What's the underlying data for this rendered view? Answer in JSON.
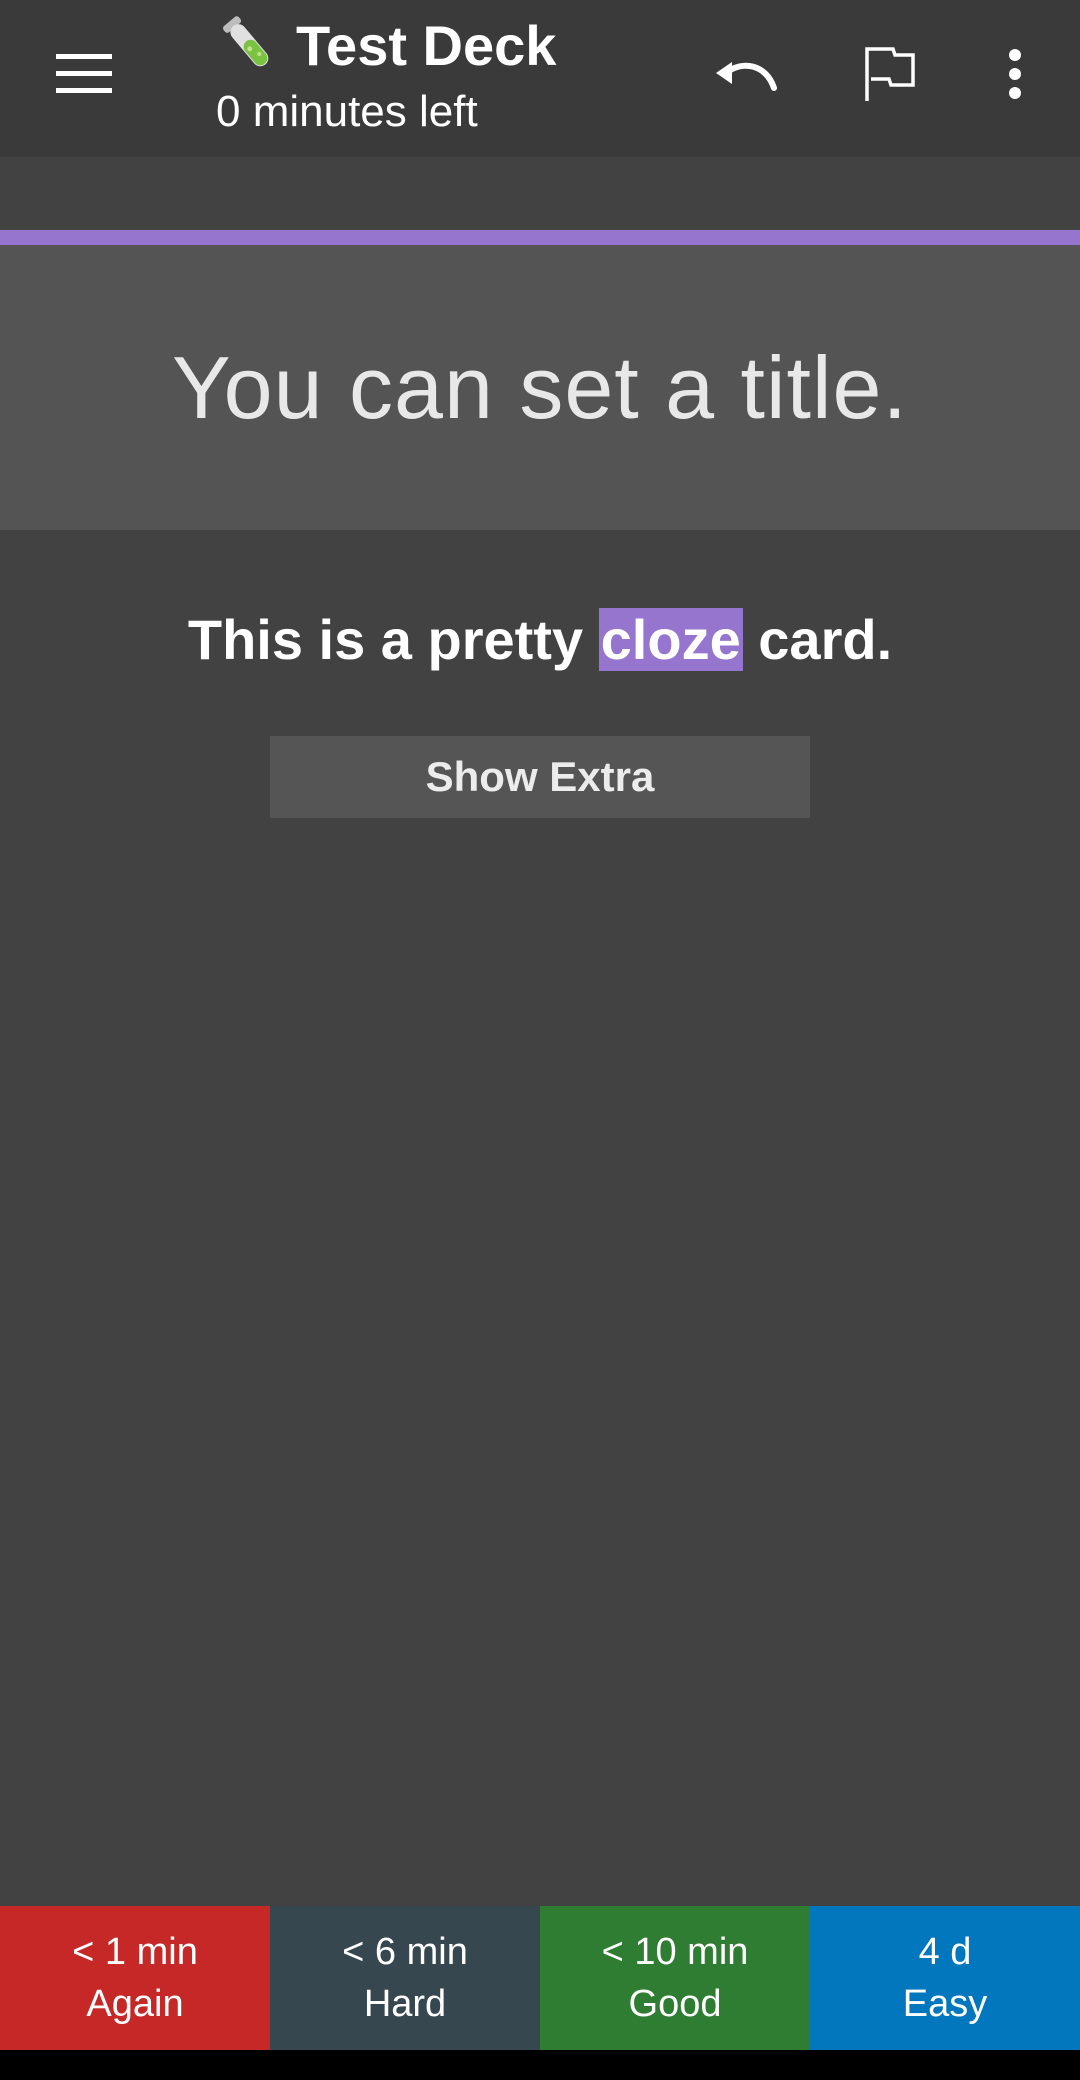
{
  "toolbar": {
    "title": "Test Deck",
    "subtitle": "0 minutes left",
    "emoji_icon": "test-tube-icon"
  },
  "card": {
    "title": "You can set a title.",
    "text_before": "This is a pretty ",
    "cloze": "cloze",
    "text_after": " card.",
    "show_extra_label": "Show Extra",
    "accent_color": "#9575cd"
  },
  "answers": [
    {
      "interval": "< 1 min",
      "label": "Again",
      "color": "#c62828"
    },
    {
      "interval": "< 6 min",
      "label": "Hard",
      "color": "#37474f"
    },
    {
      "interval": "< 10 min",
      "label": "Good",
      "color": "#2e7d32"
    },
    {
      "interval": "4 d",
      "label": "Easy",
      "color": "#0277bd"
    }
  ]
}
